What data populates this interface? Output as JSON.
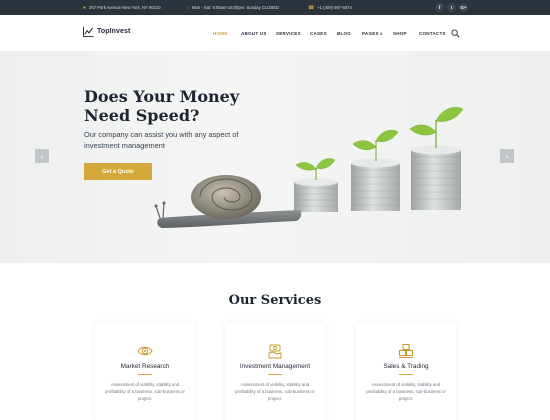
{
  "topbar": {
    "address": "267 Park Avenue New York, NY 90210",
    "hours": "Mon - Sat: 9:00am-18:00pm. Sunday CLOSED",
    "phone": "+1 (409) 987-5874",
    "social": [
      "f",
      "t",
      "G+"
    ]
  },
  "header": {
    "logo": "TopInvest",
    "nav": [
      "HOME",
      "ABOUT US",
      "SERVICES",
      "CASES",
      "BLOG",
      "PAGES",
      "SHOP",
      "CONTACTS"
    ],
    "active": "HOME"
  },
  "hero": {
    "title": "Does Your Money Need Speed?",
    "subtitle": "Our company can assist you with any aspect of investment management",
    "button": "Get a Quote",
    "prev": "‹",
    "next": "›"
  },
  "services": {
    "title": "Our Services",
    "cards": [
      {
        "title": "Market Research",
        "icon": "eye-icon",
        "text": "Assessment of viability, stability and profitability of a business, sub-business or project."
      },
      {
        "title": "Investment Management",
        "icon": "money-hand-icon",
        "text": "Assessment of viability, stability and profitability of a business, sub-business or project."
      },
      {
        "title": "Sales & Trading",
        "icon": "boxes-icon",
        "text": "Assessment of viability, stability and profitability of a business, sub-business or project."
      }
    ]
  },
  "colors": {
    "accent": "#d4a83a",
    "topbar": "#2b333d",
    "text": "#1c2430"
  }
}
